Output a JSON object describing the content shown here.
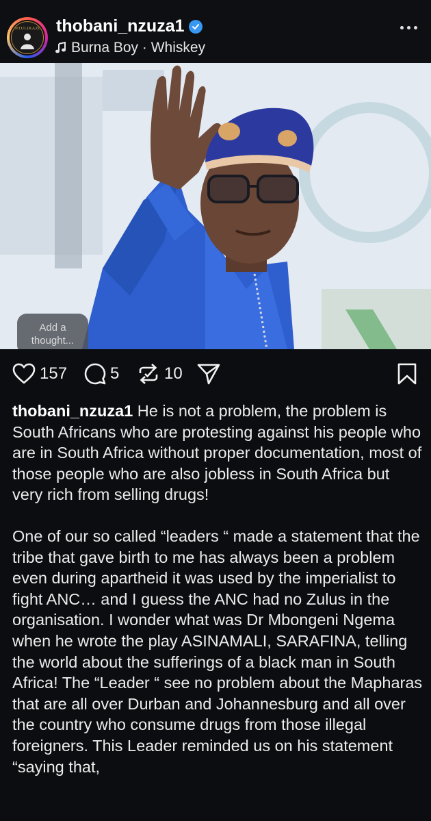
{
  "post": {
    "username": "thobani_nzuza1",
    "avatar_brand": "NTULIKAZI",
    "music_label": "Burna Boy · Whiskey"
  },
  "overlay": {
    "thought_placeholder": "Add a thought..."
  },
  "actions": {
    "likes": "157",
    "comments": "5",
    "reposts": "10"
  },
  "caption": {
    "username": "thobani_nzuza1",
    "paragraph1": "He is not a problem, the problem is South Africans who are protesting against his people who are in South Africa without proper documentation, most of those people who are also jobless in South Africa but very rich from selling drugs!",
    "paragraph2": "One of our so called “leaders “ made a statement that the tribe that gave birth to me has always been a problem even during apartheid it was used by the imperialist to fight ANC… and I guess the ANC had no Zulus in the organisation. I wonder what was Dr  Mbongeni Ngema when he wrote the play ASINAMALI, SARAFINA, telling the world about the sufferings of a black man in South Africa! The “Leader “ see no problem about the Mapharas that are all over Durban and Johannesburg and all over the country who consume drugs from those illegal foreigners. This Leader reminded us on his statement “saying that,"
  },
  "colors": {
    "background": "#0b0d10",
    "verified": "#3897f0",
    "repost_badge": "#8a3cf2",
    "agbada": "#2f5fcf"
  }
}
